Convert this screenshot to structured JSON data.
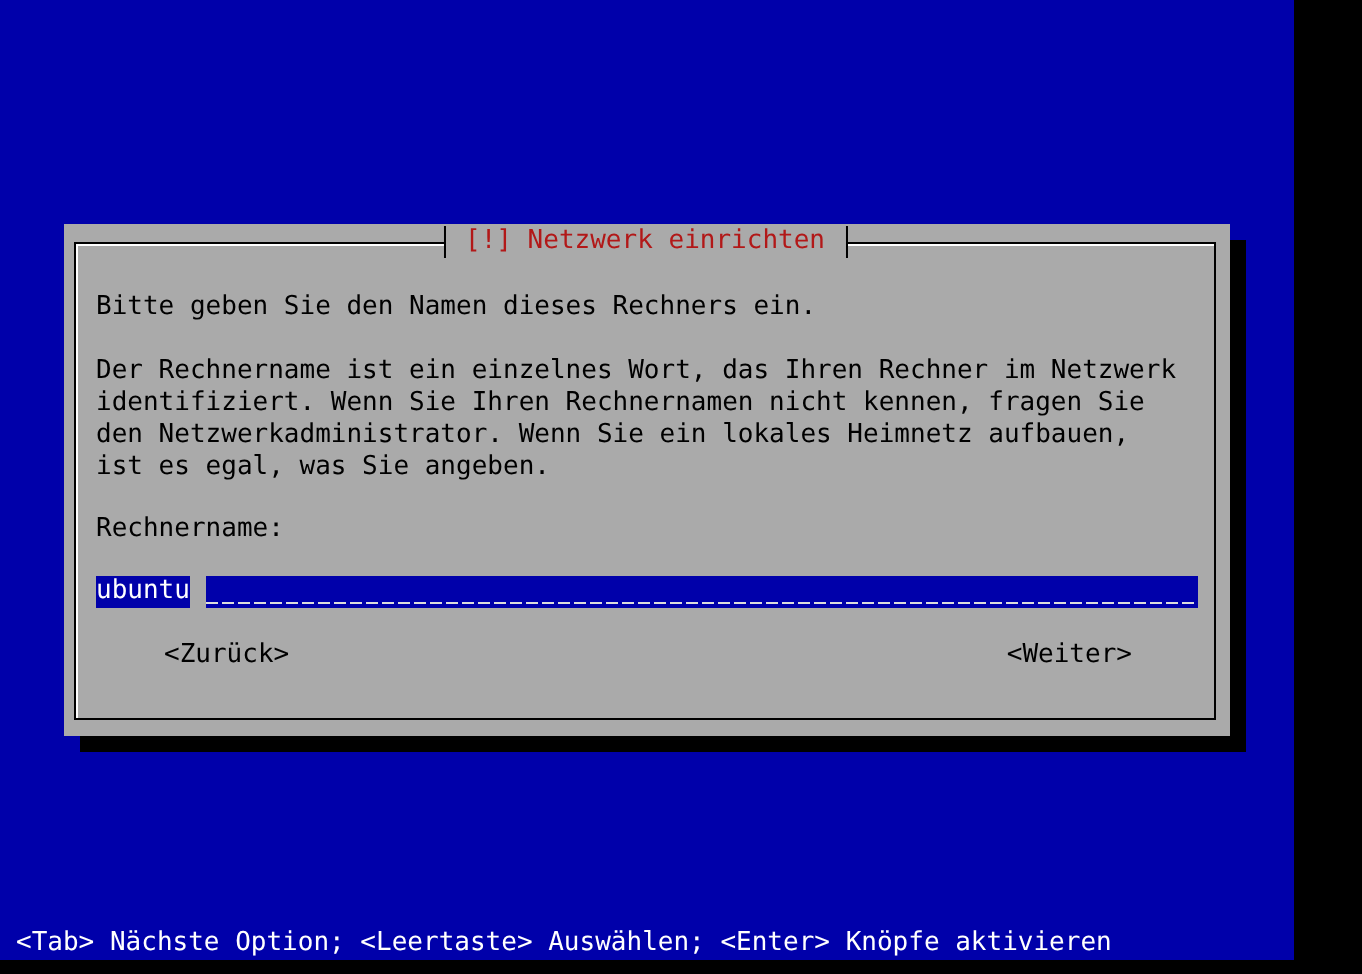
{
  "dialog": {
    "title": "[!] Netzwerk einrichten",
    "paragraphs": [
      "Bitte geben Sie den Namen dieses Rechners ein.",
      "Der Rechnername ist ein einzelnes Wort, das Ihren Rechner im Netzwerk identifiziert. Wenn Sie Ihren Rechnernamen nicht kennen, fragen Sie den Netzwerkadministrator. Wenn Sie ein lokales Heimnetz aufbauen, ist es egal, was Sie angeben."
    ],
    "field": {
      "label": "Rechnername:",
      "value": "ubuntu"
    },
    "buttons": [
      "<Zurück>",
      "<Weiter>"
    ]
  },
  "status_bar": "<Tab> Nächste Option; <Leertaste> Auswählen; <Enter> Knöpfe aktivieren"
}
